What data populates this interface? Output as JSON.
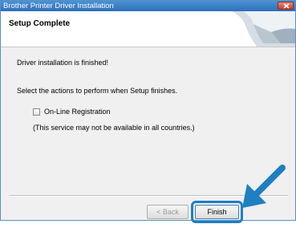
{
  "window": {
    "title": "Brother Printer Driver Installation",
    "close_icon": "close-icon"
  },
  "header": {
    "title": "Setup Complete",
    "graphic_icon": "page-curl-graphic"
  },
  "content": {
    "message": "Driver installation is finished!",
    "prompt": "Select the actions to perform when Setup finishes.",
    "checkbox_label": "On-Line Registration",
    "checkbox_checked": false,
    "note": "(This service may not be available in all countries.)"
  },
  "buttons": {
    "back_label": "< Back",
    "back_enabled": false,
    "finish_label": "Finish"
  },
  "overlay": {
    "arrow_icon": "pointer-arrow-icon",
    "highlight_color": "#1e7fc1"
  },
  "colors": {
    "titlebar": "#3a80c6",
    "accent": "#1e7fc1"
  }
}
